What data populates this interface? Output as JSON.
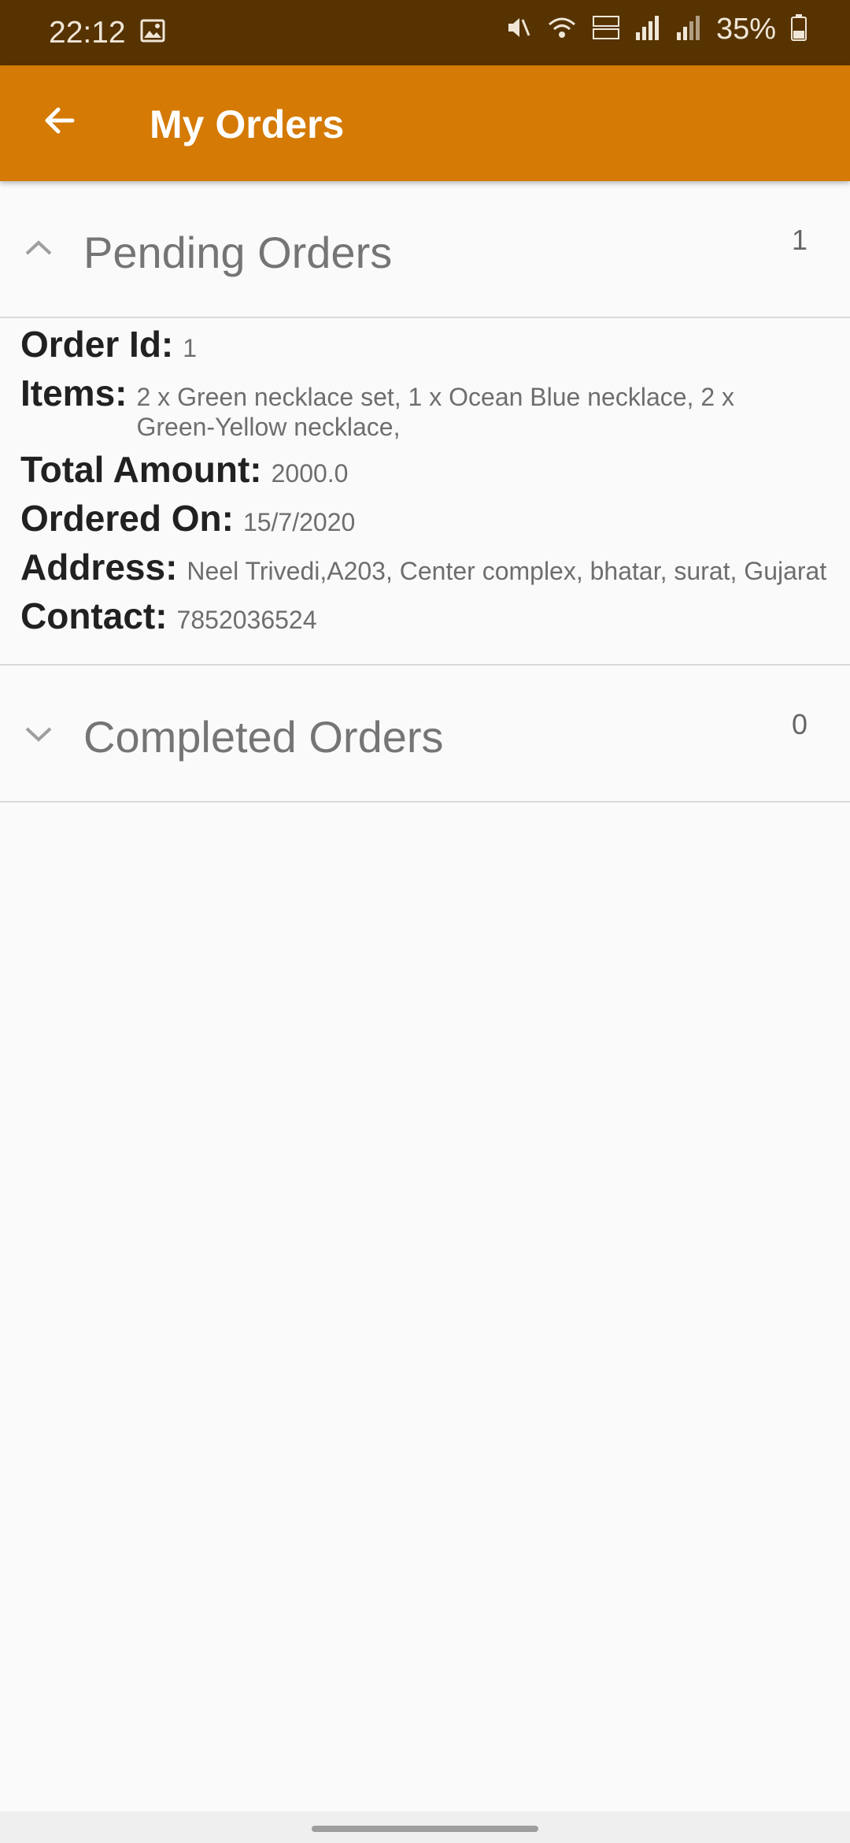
{
  "status_bar": {
    "time": "22:12",
    "battery": "35%"
  },
  "app_bar": {
    "title": "My Orders"
  },
  "pending": {
    "title": "Pending Orders",
    "count": "1",
    "order": {
      "id_label": "Order Id:",
      "id": "1",
      "items_label": "Items:",
      "items": "2 x Green necklace set, 1 x Ocean Blue necklace, 2 x Green-Yellow necklace,",
      "total_label": "Total Amount:",
      "total": "2000.0",
      "ordered_label": "Ordered On:",
      "ordered": "15/7/2020",
      "address_label": "Address:",
      "address": "Neel Trivedi,A203, Center complex, bhatar, surat, Gujarat",
      "contact_label": "Contact:",
      "contact": "7852036524"
    }
  },
  "completed": {
    "title": "Completed Orders",
    "count": "0"
  }
}
